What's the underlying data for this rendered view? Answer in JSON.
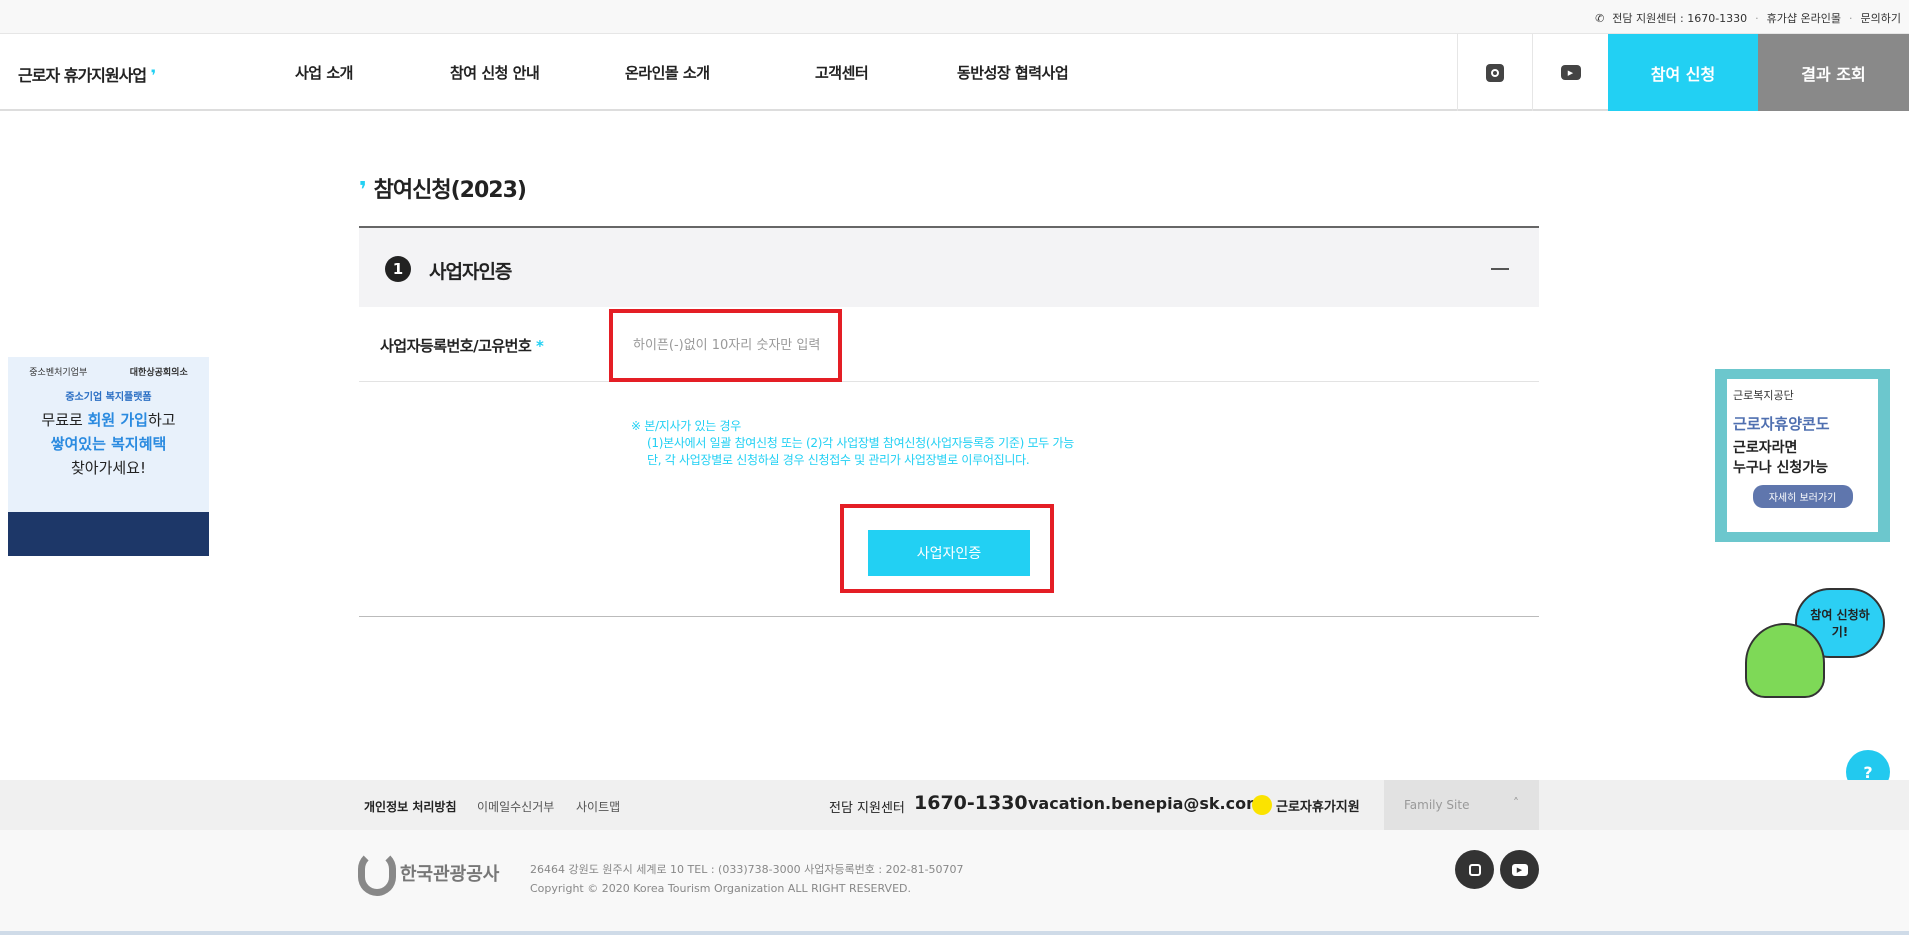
{
  "topbar": {
    "phone_icon": "phone-icon",
    "center": "전담 지원센터 : 1670-1330",
    "mall": "휴가샵 온라인몰",
    "inquiry": "문의하기"
  },
  "header": {
    "logo": "근로자 휴가지원사업",
    "nav": [
      "사업 소개",
      "참여 신청 안내",
      "온라인몰 소개",
      "고객센터",
      "동반성장 협력사업"
    ],
    "apply": "참여 신청",
    "result": "결과 조회"
  },
  "page": {
    "title": "참여신청(2023)"
  },
  "section": {
    "number": "1",
    "title": "사업자인증",
    "field_label": "사업자등록번호/고유번호",
    "required": "*",
    "placeholder": "하이픈(-)없이 10자리 숫자만 입력",
    "value": "",
    "notice": [
      "※ 본/지사가 있는 경우",
      "(1)본사에서 일괄 참여신청 또는 (2)각 사업장별 참여신청(사업자등록증 기준) 모두 가능",
      "단, 각 사업장별로 신청하실 경우 신청접수 및 관리가 사업장별로 이루어집니다."
    ],
    "button": "사업자인증"
  },
  "banner_left": {
    "orgs": [
      "중소벤처기업부",
      "대한상공회의소"
    ],
    "platform": "중소기업 복지플랫폼",
    "line1a": "무료로 ",
    "line1b": "회원 가입",
    "line1c": "하고",
    "line2": "쌓여있는 복지혜택",
    "line3": "찾아가세요!"
  },
  "banner_right": {
    "org": "근로복지공단",
    "line1": "근로자휴양콘도",
    "line2": "근로자라면",
    "line3": "누구나 신청가능",
    "button": "자세히 보러가기"
  },
  "character": {
    "bubble": "참여 신청하기!"
  },
  "footer": {
    "links": [
      "개인정보 처리방침",
      "이메일수신거부",
      "사이트맵"
    ],
    "center_label": "전담 지원센터",
    "center_phone": "1670-1330",
    "email": "vacation.benepia@sk.com",
    "kakao": "근로자휴가지원",
    "family_site": "Family Site",
    "org_logo": "한국관광공사",
    "address": "26464 강원도 원주시 세계로 10 TEL : (033)738-3000 사업자등록번호 : 202-81-50707",
    "copyright": "Copyright © 2020 Korea Tourism Organization ALL RIGHT RESERVED."
  },
  "colors": {
    "accent": "#22d0f3",
    "highlight": "#e41e25",
    "result_button": "#898989"
  }
}
